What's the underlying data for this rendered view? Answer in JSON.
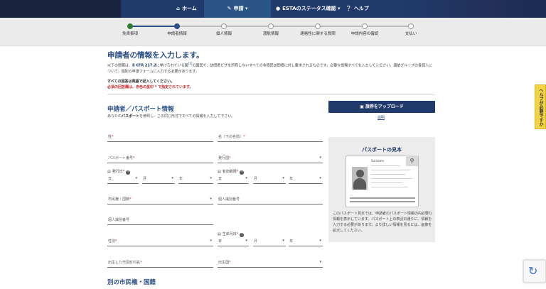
{
  "nav": {
    "home": "ホーム",
    "apply": "申請",
    "status": "ESTAのステータス確認",
    "help": "ヘルプ"
  },
  "progress": {
    "steps": [
      "免責事項",
      "申請者情報",
      "個人情報",
      "渡航情報",
      "適格性に関する質問",
      "申請内容の確認",
      "支払い"
    ],
    "current_index": 1
  },
  "main": {
    "title": "申請者の情報を入力します。",
    "intro_pre": "以下の情報は、",
    "intro_link": "8 CFR 217.2",
    "intro_rest": "に挙げられている国",
    "intro_rest2": "の国民で、訪問者ビザを所有しないすべての非移民訪問者に対し要求されるものです。必要な情報すべてを入力してください。渡航グループの各個人について、個別の申請フォームに入力する必要があります。",
    "req_english": "すべての回答は英語で記入してください。",
    "req_marked_red": "必須の回答欄は、赤色の星印 * で指定されています。",
    "section_title": "申請者／パスポート情報",
    "section_sub_pre": "あなたの",
    "section_sub_bold": "パスポート",
    "section_sub_post": "を参照し、この同じ形式ですべての情報を入力して下さい。",
    "upload_button": "旅券をアップロード",
    "upload_help": "説明",
    "next_section_title": "別の市民権・国籍"
  },
  "fields": {
    "surname": "姓",
    "given_name": "名（下の名前）",
    "passport_number": "パスポート番号",
    "issuing_country": "発行国",
    "issue_date": "発行日",
    "expiry_date": "有効期限",
    "day": "日",
    "month": "月",
    "year": "年",
    "citizenship": "市民権・国籍",
    "personal_id": "個人識別番号",
    "personal_id2": "個人識別番号",
    "gender": "性別",
    "dob": "生年月日",
    "birth_city": "出生した市区町村名",
    "birth_country": "出生国"
  },
  "sample": {
    "title": "パスポートの見本",
    "passport_header": "Surname",
    "description": "このパスポート見本では、申請者のパスポート情報の内必要な情報を表示しています。パスポート上の表記の通りに、情報を入力する必要があります。より詳しい情報を見るには、画像を拡大してください。"
  },
  "side_tab": "ヘルプが必要ですか",
  "colors": {
    "nav": "#1f3a6b",
    "accent": "#2b4f85",
    "required": "#c62828",
    "help_tab": "#f3d544"
  },
  "icons": {
    "home": "home-icon",
    "pencil": "pencil-icon",
    "person": "person-icon",
    "help": "help-circle-icon",
    "camera": "camera-icon",
    "calendar": "calendar-icon",
    "zoom": "search-icon"
  }
}
